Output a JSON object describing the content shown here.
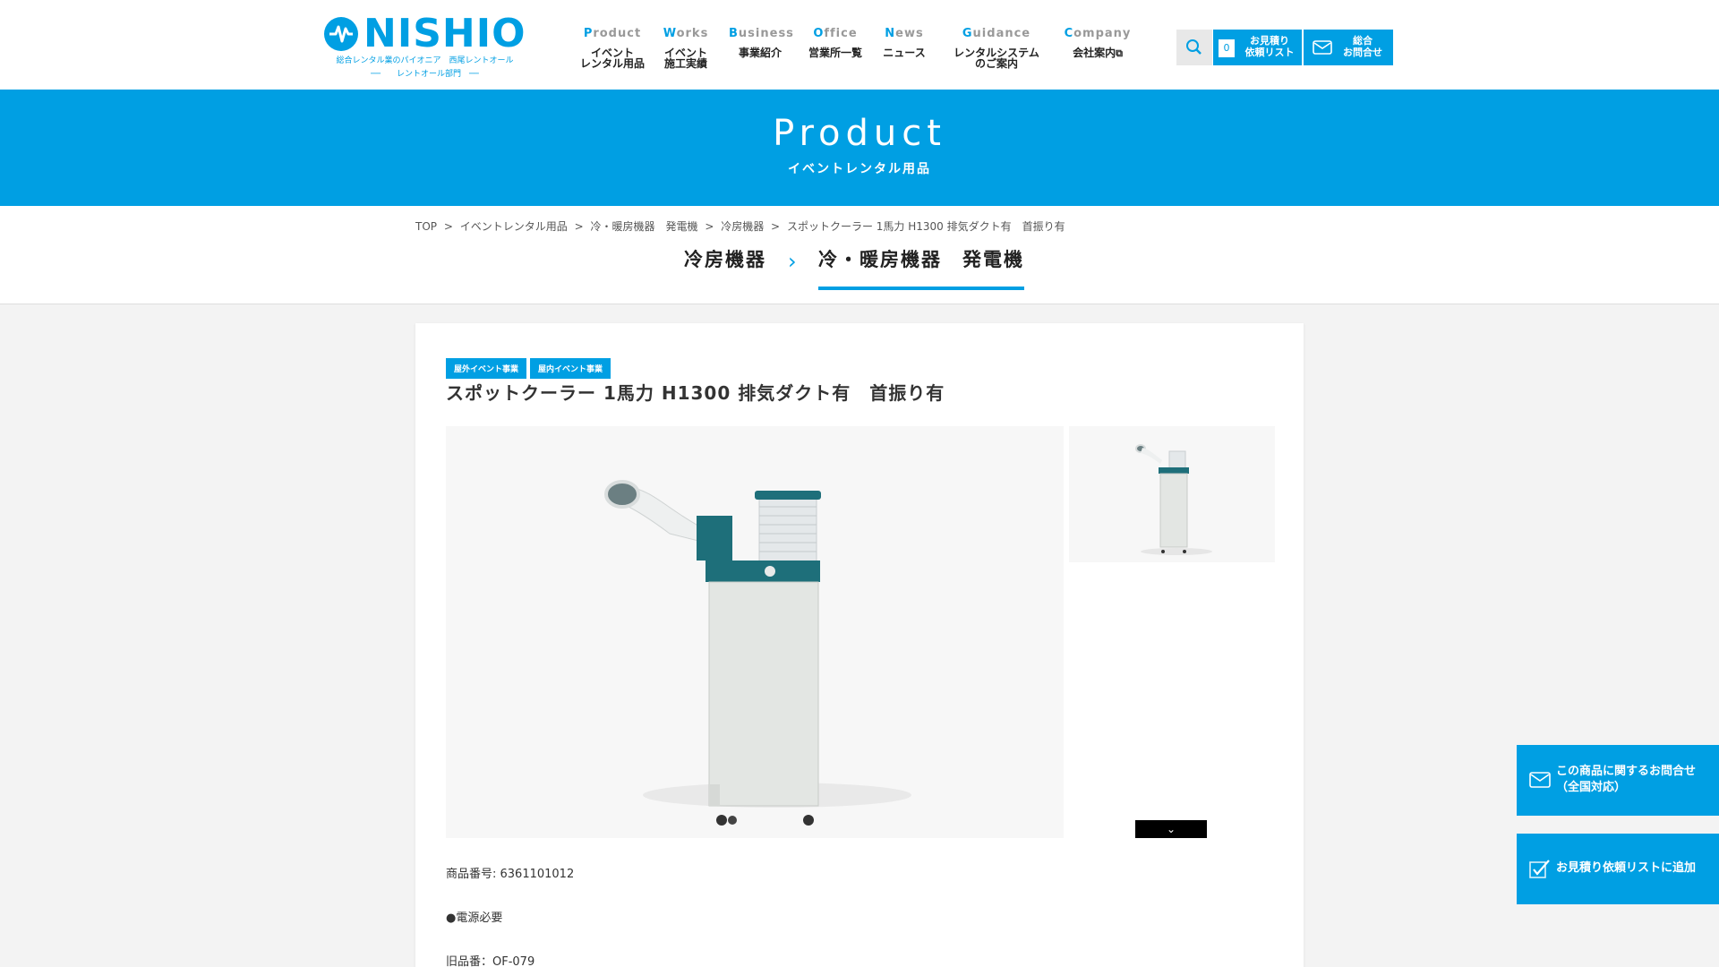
{
  "logo": {
    "text": "NISHIO",
    "tagline": "総合レンタル業のパイオニア　西尾レントオール",
    "division": "──　　レントオール部門　──"
  },
  "nav": [
    {
      "en": "Product",
      "jp1": "イベント",
      "jp2": "レンタル用品"
    },
    {
      "en": "Works",
      "jp1": "イベント",
      "jp2": "施工実績"
    },
    {
      "en": "Business",
      "jp1": "事業紹介",
      "jp2": ""
    },
    {
      "en": "Office",
      "jp1": "営業所一覧",
      "jp2": ""
    },
    {
      "en": "News",
      "jp1": "ニュース",
      "jp2": ""
    },
    {
      "en": "Guidance",
      "jp1": "レンタルシステム",
      "jp2": "のご案内"
    },
    {
      "en": "Company",
      "jp1": "会社案内",
      "jp2": ""
    }
  ],
  "header_actions": {
    "quote_count": "0",
    "quote_label_1": "お見積り",
    "quote_label_2": "依頼リスト",
    "contact_label_1": "総合",
    "contact_label_2": "お問合せ"
  },
  "hero": {
    "title": "Product",
    "subtitle": "イベントレンタル用品"
  },
  "breadcrumb": [
    "TOP",
    ">",
    "イベントレンタル用品",
    ">",
    "冷・暖房機器　発電機",
    ">",
    "冷房機器",
    ">",
    "スポットクーラー 1馬力 H1300 排気ダクト有　首振り有"
  ],
  "category_tabs": {
    "child": "冷房機器",
    "parent": "冷・暖房機器　発電機"
  },
  "product": {
    "tags": [
      "屋外イベント事業",
      "屋内イベント事業"
    ],
    "title": "スポットクーラー 1馬力 H1300 排気ダクト有　首振り有",
    "number": "商品番号: 6361101012",
    "power": "●電源必要",
    "old_number": "旧品番：OF-079"
  },
  "float_buttons": {
    "inquiry_1": "この商品に関するお問合せ",
    "inquiry_2": "（全国対応）",
    "add_quote": "お見積り依頼リストに追加"
  },
  "colors": {
    "accent": "#009fe3",
    "teal": "#1e6f7a"
  }
}
